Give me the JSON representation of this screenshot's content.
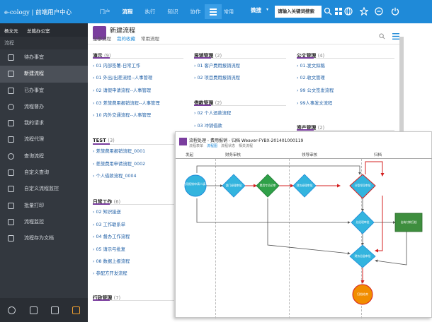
{
  "brand": {
    "logo": "e-cology | 前端用户中心"
  },
  "topnav": {
    "items": [
      "门户",
      "流程",
      "执行",
      "知识",
      "协作"
    ],
    "active": "流程",
    "common": "常用"
  },
  "search": {
    "scope": "微搜",
    "placeholder": "请输入关键词搜索"
  },
  "user": {
    "name": "杨文元",
    "dept": "总裁办公室"
  },
  "sidebar": {
    "title": "流程",
    "items": [
      {
        "label": "待办事宜",
        "icon": "todo-icon"
      },
      {
        "label": "新建流程",
        "icon": "new-workflow-icon",
        "active": true
      },
      {
        "label": "已办事宜",
        "icon": "done-icon"
      },
      {
        "label": "流程督办",
        "icon": "supervise-icon"
      },
      {
        "label": "我的请求",
        "icon": "request-icon"
      },
      {
        "label": "流程代理",
        "icon": "proxy-icon"
      },
      {
        "label": "查询流程",
        "icon": "search-workflow-icon"
      },
      {
        "label": "自定义查询",
        "icon": "custom-query-icon"
      },
      {
        "label": "自定义流程监控",
        "icon": "monitor-icon"
      },
      {
        "label": "批量打印",
        "icon": "print-icon"
      },
      {
        "label": "流程监控",
        "icon": "workflow-monitor-icon"
      },
      {
        "label": "流程存为文档",
        "icon": "save-doc-icon"
      }
    ]
  },
  "main": {
    "title": "新建流程",
    "tabs": [
      "全部流程",
      "我的收藏",
      "常用流程"
    ],
    "active_tab": "我的收藏",
    "groups": {
      "yanshi": {
        "title": "演示",
        "count": "(9)",
        "items": [
          "01 内部签署-日常工作",
          "01 外出/出差流程--人事管理",
          "02 请假申请流程--人事管理",
          "03 差旅费用报销流程--人事管理",
          "10 内外交通流程--人事管理"
        ]
      },
      "baoxiao": {
        "title": "报销管理",
        "count": "(2)",
        "items": [
          "01 客户费用报销流程",
          "02 项目费用报销流程"
        ]
      },
      "jiekuan": {
        "title": "借款管理",
        "count": "(2)",
        "items": [
          "02 个人还款流程",
          "03 冲销借款"
        ]
      },
      "gongwen": {
        "title": "公文管理",
        "count": "(4)",
        "items": [
          "01.发文拟稿",
          "02.收文管理",
          "99 公文签发流程",
          "99人事发文流程"
        ]
      },
      "zichan": {
        "title": "资产管理",
        "count": "(2)"
      },
      "test": {
        "title": "TEST",
        "count": "(3)",
        "items": [
          "差旅费用报销流程_0001",
          "差旅费用申请流程_0002",
          "个人借款流程_0004"
        ]
      },
      "richang": {
        "title": "日常工作",
        "count": "(6)",
        "items": [
          "02 知识接送",
          "03 工作联系单",
          "04 督办工作流程",
          "05 请示与批复",
          "08 数据上报流程",
          "参配方开发流程"
        ]
      },
      "xingzheng": {
        "title": "行政管理",
        "count": "(7)"
      }
    }
  },
  "popup": {
    "title": "流程处理 - 费用报销 - 归档 Weaver-FYBX-201401000119",
    "tabs": [
      "流程表单",
      "流程图",
      "流程状态",
      "相关流程"
    ],
    "active_tab": "流程图",
    "lanes": [
      "发起",
      "财务审核",
      "领导审核",
      "归档"
    ],
    "nodes": {
      "start": "费用报销申请人填写",
      "n1": "部门经理审批",
      "n2": "费用专员初审",
      "n3": "财务经理审批",
      "n4": "分管领导审批",
      "n5": "总经理审批",
      "n6": "财务总监审批",
      "n7": "出纳付款归档",
      "end": "归档结束"
    }
  },
  "colors": {
    "topbar": "#1f8ad8",
    "sidebar": "#33383f",
    "accent": "#7a3d9e",
    "node": "#33b4de",
    "green": "#3e8e3e",
    "orange": "#f18d00"
  }
}
